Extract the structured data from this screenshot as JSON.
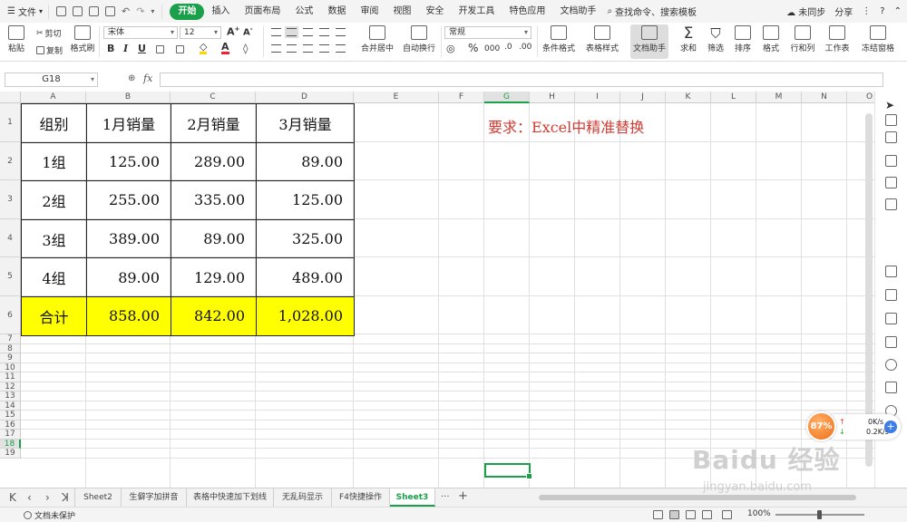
{
  "menubar": {
    "file": "文件",
    "tabs": [
      "开始",
      "插入",
      "页面布局",
      "公式",
      "数据",
      "审阅",
      "视图",
      "安全",
      "开发工具",
      "特色应用",
      "文档助手"
    ],
    "active_tab": "开始",
    "search": "查找命令、搜索模板",
    "sync": "未同步",
    "share": "分享"
  },
  "ribbon": {
    "paste": "粘贴",
    "cut": "剪切",
    "copy": "复制",
    "format_painter": "格式刷",
    "font_name": "宋体",
    "font_size": "12",
    "merge_center": "合并居中",
    "wrap_text": "自动换行",
    "number_format": "常规",
    "cond_format": "条件格式",
    "table_style": "表格样式",
    "doc_helper": "文档助手",
    "sum": "求和",
    "filter": "筛选",
    "sort": "排序",
    "format": "格式",
    "row_col": "行和列",
    "worksheet": "工作表",
    "freeze": "冻结窗格"
  },
  "formula_bar": {
    "name_box": "G18",
    "fx": "fx",
    "value": ""
  },
  "grid": {
    "columns": [
      "A",
      "B",
      "C",
      "D",
      "E",
      "F",
      "G",
      "H",
      "I",
      "J",
      "K",
      "L",
      "M",
      "N",
      "O"
    ],
    "selected_column": "G",
    "rows": [
      "1",
      "2",
      "3",
      "4",
      "5",
      "6",
      "7",
      "8",
      "9",
      "10",
      "11",
      "12",
      "13",
      "14",
      "15",
      "16",
      "17",
      "18",
      "19"
    ],
    "selected_row": "18",
    "table": {
      "header": [
        "组别",
        "1月销量",
        "2月销量",
        "3月销量"
      ],
      "rows": [
        [
          "1组",
          "125.00",
          "289.00",
          "89.00"
        ],
        [
          "2组",
          "255.00",
          "335.00",
          "125.00"
        ],
        [
          "3组",
          "389.00",
          "89.00",
          "325.00"
        ],
        [
          "4组",
          "89.00",
          "129.00",
          "489.00"
        ]
      ],
      "total": [
        "合计",
        "858.00",
        "842.00",
        "1,028.00"
      ]
    },
    "requirement": "要求：Excel中精准替换"
  },
  "network": {
    "percent": "87%",
    "up": "0K/s",
    "down": "0.2K/s"
  },
  "sheets": {
    "tabs": [
      "Sheet2",
      "生僻字加拼音",
      "表格中快速加下划线",
      "无乱码显示",
      "F4快捷操作",
      "Sheet3"
    ],
    "active": "Sheet3",
    "more": "···",
    "add": "+"
  },
  "status": {
    "protection": "文档未保护",
    "zoom": "100%"
  },
  "watermark": {
    "brand": "Baidu 经验",
    "url": "jingyan.baidu.com"
  }
}
